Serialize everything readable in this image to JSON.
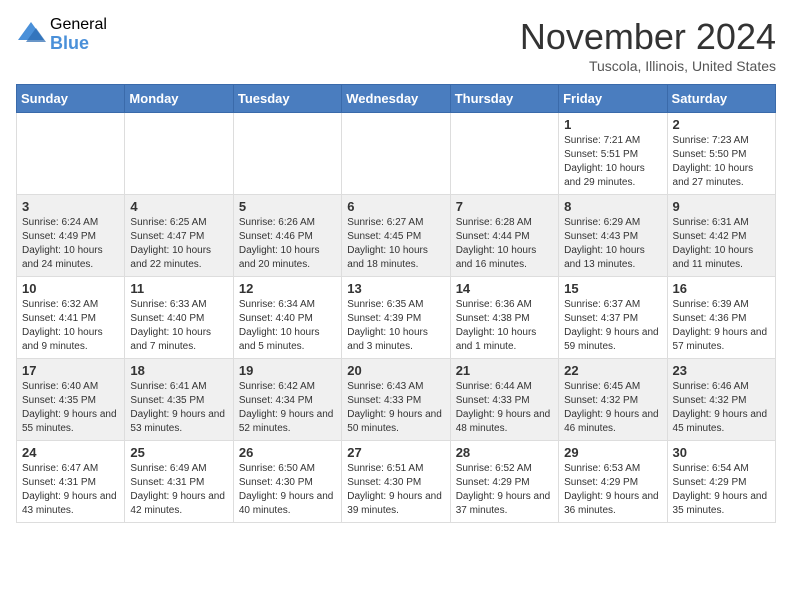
{
  "header": {
    "logo_general": "General",
    "logo_blue": "Blue",
    "month_title": "November 2024",
    "location": "Tuscola, Illinois, United States"
  },
  "weekdays": [
    "Sunday",
    "Monday",
    "Tuesday",
    "Wednesday",
    "Thursday",
    "Friday",
    "Saturday"
  ],
  "weeks": [
    [
      {
        "day": "",
        "info": ""
      },
      {
        "day": "",
        "info": ""
      },
      {
        "day": "",
        "info": ""
      },
      {
        "day": "",
        "info": ""
      },
      {
        "day": "",
        "info": ""
      },
      {
        "day": "1",
        "info": "Sunrise: 7:21 AM\nSunset: 5:51 PM\nDaylight: 10 hours and 29 minutes."
      },
      {
        "day": "2",
        "info": "Sunrise: 7:23 AM\nSunset: 5:50 PM\nDaylight: 10 hours and 27 minutes."
      }
    ],
    [
      {
        "day": "3",
        "info": "Sunrise: 6:24 AM\nSunset: 4:49 PM\nDaylight: 10 hours and 24 minutes."
      },
      {
        "day": "4",
        "info": "Sunrise: 6:25 AM\nSunset: 4:47 PM\nDaylight: 10 hours and 22 minutes."
      },
      {
        "day": "5",
        "info": "Sunrise: 6:26 AM\nSunset: 4:46 PM\nDaylight: 10 hours and 20 minutes."
      },
      {
        "day": "6",
        "info": "Sunrise: 6:27 AM\nSunset: 4:45 PM\nDaylight: 10 hours and 18 minutes."
      },
      {
        "day": "7",
        "info": "Sunrise: 6:28 AM\nSunset: 4:44 PM\nDaylight: 10 hours and 16 minutes."
      },
      {
        "day": "8",
        "info": "Sunrise: 6:29 AM\nSunset: 4:43 PM\nDaylight: 10 hours and 13 minutes."
      },
      {
        "day": "9",
        "info": "Sunrise: 6:31 AM\nSunset: 4:42 PM\nDaylight: 10 hours and 11 minutes."
      }
    ],
    [
      {
        "day": "10",
        "info": "Sunrise: 6:32 AM\nSunset: 4:41 PM\nDaylight: 10 hours and 9 minutes."
      },
      {
        "day": "11",
        "info": "Sunrise: 6:33 AM\nSunset: 4:40 PM\nDaylight: 10 hours and 7 minutes."
      },
      {
        "day": "12",
        "info": "Sunrise: 6:34 AM\nSunset: 4:40 PM\nDaylight: 10 hours and 5 minutes."
      },
      {
        "day": "13",
        "info": "Sunrise: 6:35 AM\nSunset: 4:39 PM\nDaylight: 10 hours and 3 minutes."
      },
      {
        "day": "14",
        "info": "Sunrise: 6:36 AM\nSunset: 4:38 PM\nDaylight: 10 hours and 1 minute."
      },
      {
        "day": "15",
        "info": "Sunrise: 6:37 AM\nSunset: 4:37 PM\nDaylight: 9 hours and 59 minutes."
      },
      {
        "day": "16",
        "info": "Sunrise: 6:39 AM\nSunset: 4:36 PM\nDaylight: 9 hours and 57 minutes."
      }
    ],
    [
      {
        "day": "17",
        "info": "Sunrise: 6:40 AM\nSunset: 4:35 PM\nDaylight: 9 hours and 55 minutes."
      },
      {
        "day": "18",
        "info": "Sunrise: 6:41 AM\nSunset: 4:35 PM\nDaylight: 9 hours and 53 minutes."
      },
      {
        "day": "19",
        "info": "Sunrise: 6:42 AM\nSunset: 4:34 PM\nDaylight: 9 hours and 52 minutes."
      },
      {
        "day": "20",
        "info": "Sunrise: 6:43 AM\nSunset: 4:33 PM\nDaylight: 9 hours and 50 minutes."
      },
      {
        "day": "21",
        "info": "Sunrise: 6:44 AM\nSunset: 4:33 PM\nDaylight: 9 hours and 48 minutes."
      },
      {
        "day": "22",
        "info": "Sunrise: 6:45 AM\nSunset: 4:32 PM\nDaylight: 9 hours and 46 minutes."
      },
      {
        "day": "23",
        "info": "Sunrise: 6:46 AM\nSunset: 4:32 PM\nDaylight: 9 hours and 45 minutes."
      }
    ],
    [
      {
        "day": "24",
        "info": "Sunrise: 6:47 AM\nSunset: 4:31 PM\nDaylight: 9 hours and 43 minutes."
      },
      {
        "day": "25",
        "info": "Sunrise: 6:49 AM\nSunset: 4:31 PM\nDaylight: 9 hours and 42 minutes."
      },
      {
        "day": "26",
        "info": "Sunrise: 6:50 AM\nSunset: 4:30 PM\nDaylight: 9 hours and 40 minutes."
      },
      {
        "day": "27",
        "info": "Sunrise: 6:51 AM\nSunset: 4:30 PM\nDaylight: 9 hours and 39 minutes."
      },
      {
        "day": "28",
        "info": "Sunrise: 6:52 AM\nSunset: 4:29 PM\nDaylight: 9 hours and 37 minutes."
      },
      {
        "day": "29",
        "info": "Sunrise: 6:53 AM\nSunset: 4:29 PM\nDaylight: 9 hours and 36 minutes."
      },
      {
        "day": "30",
        "info": "Sunrise: 6:54 AM\nSunset: 4:29 PM\nDaylight: 9 hours and 35 minutes."
      }
    ]
  ]
}
